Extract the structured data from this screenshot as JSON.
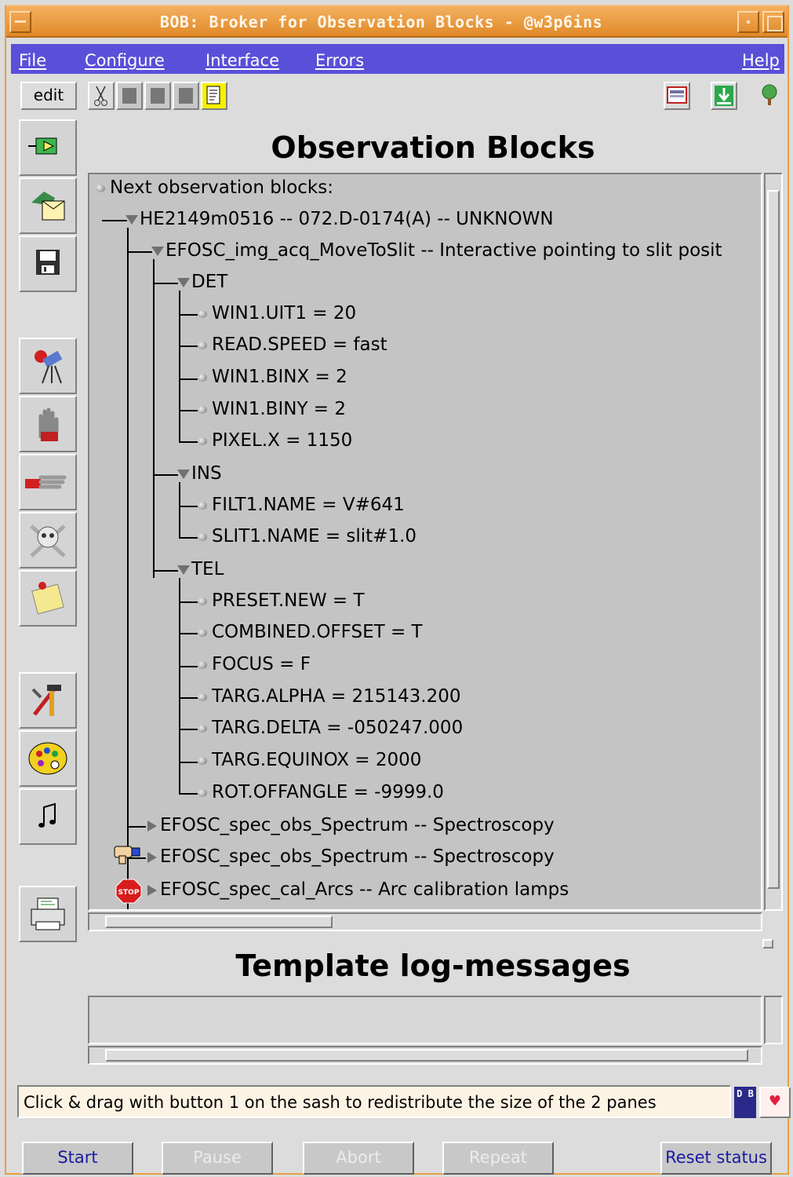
{
  "window": {
    "title": "BOB: Broker for Observation Blocks - @w3p6ins"
  },
  "menubar": {
    "items": [
      {
        "label": "File"
      },
      {
        "label": "Configure"
      },
      {
        "label": "Interface"
      },
      {
        "label": "Errors"
      },
      {
        "label": "Help"
      }
    ]
  },
  "toolbar": {
    "edit_label": "edit",
    "icons": [
      "cut-icon",
      "copy-icon",
      "paste-icon",
      "paste-alt-icon",
      "notepad-icon",
      "display-icon",
      "download-icon",
      "tree-icon"
    ]
  },
  "lefttool": {
    "icons": [
      "load-ob-icon",
      "fetch-ob-icon",
      "save-icon",
      "telescope-icon",
      "stop-hand-icon",
      "pointing-hand-icon",
      "skull-icon",
      "note-icon",
      "tools-icon",
      "palette-icon",
      "music-icon",
      "printer-icon"
    ]
  },
  "main": {
    "heading": "Observation Blocks",
    "tree": {
      "root_label": "Next observation blocks:",
      "ob_label": "HE2149m0516 -- 072.D-0174(A) -- UNKNOWN",
      "template1_label": "EFOSC_img_acq_MoveToSlit -- Interactive pointing to slit posit",
      "groups": [
        {
          "label": "DET",
          "params": [
            "WIN1.UIT1 = 20",
            "READ.SPEED = fast",
            "WIN1.BINX = 2",
            "WIN1.BINY = 2",
            "PIXEL.X = 1150"
          ]
        },
        {
          "label": "INS",
          "params": [
            "FILT1.NAME = V#641",
            "SLIT1.NAME = slit#1.0"
          ]
        },
        {
          "label": "TEL",
          "params": [
            "PRESET.NEW = T",
            "COMBINED.OFFSET = T",
            "FOCUS = F",
            "TARG.ALPHA = 215143.200",
            "TARG.DELTA = -050247.000",
            "TARG.EQUINOX = 2000",
            "ROT.OFFANGLE = -9999.0"
          ]
        }
      ],
      "template2_label": "EFOSC_spec_obs_Spectrum -- Spectroscopy",
      "template3_label": "EFOSC_spec_obs_Spectrum -- Spectroscopy",
      "template4_label": "EFOSC_spec_cal_Arcs -- Arc calibration lamps",
      "stop_label": "STOP"
    }
  },
  "log": {
    "heading": "Template log-messages"
  },
  "status": {
    "message": "Click & drag with button 1 on the sash to redistribute the size of the 2 panes",
    "db_label": "D B"
  },
  "buttons": {
    "start": "Start",
    "pause": "Pause",
    "abort": "Abort",
    "repeat": "Repeat",
    "reset": "Reset status"
  },
  "colors": {
    "titlebar": "#e08a28",
    "menubar": "#5a4fd8",
    "tree_bg": "#c4c4c4",
    "status_bg": "#fdf3e4",
    "stop_red": "#d81c1c"
  }
}
